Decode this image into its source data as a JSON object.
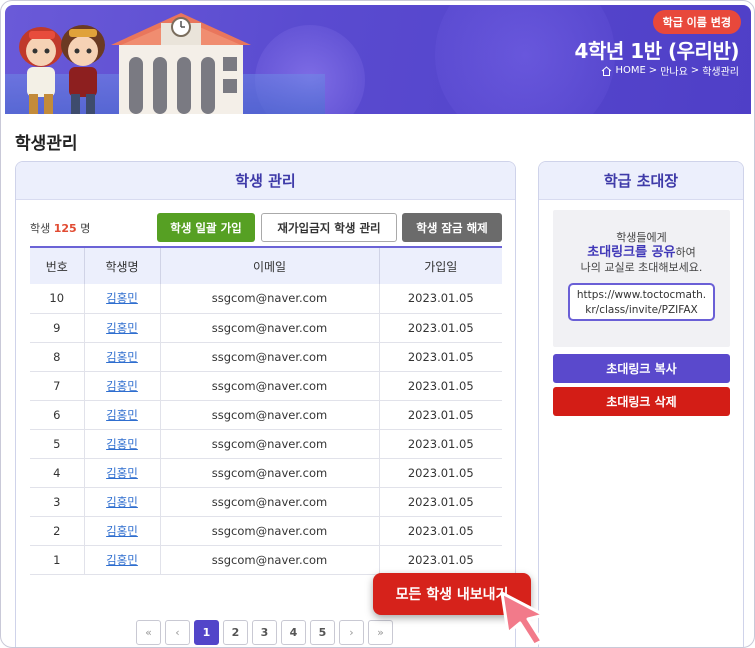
{
  "header": {
    "change_name_label": "학급 이름 변경",
    "class_title": "4학년 1반 (우리반)",
    "breadcrumb": [
      "HOME",
      ">",
      "만나요",
      ">",
      "학생관리"
    ]
  },
  "page_title": "학생관리",
  "student_panel": {
    "title": "학생 관리",
    "count_prefix": "학생",
    "count_value": "125",
    "count_suffix": "명",
    "bulk_join_label": "학생 일괄 가입",
    "rejoin_ban_label": "재가입금지 학생 관리",
    "unlock_label": "학생 잠금 해제",
    "columns": [
      "번호",
      "학생명",
      "이메일",
      "가입일"
    ],
    "rows": [
      {
        "no": "10",
        "name": "김홍민",
        "email": "ssgcom@naver.com",
        "date": "2023.01.05"
      },
      {
        "no": "9",
        "name": "김홍민",
        "email": "ssgcom@naver.com",
        "date": "2023.01.05"
      },
      {
        "no": "8",
        "name": "김홍민",
        "email": "ssgcom@naver.com",
        "date": "2023.01.05"
      },
      {
        "no": "7",
        "name": "김홍민",
        "email": "ssgcom@naver.com",
        "date": "2023.01.05"
      },
      {
        "no": "6",
        "name": "김홍민",
        "email": "ssgcom@naver.com",
        "date": "2023.01.05"
      },
      {
        "no": "5",
        "name": "김홍민",
        "email": "ssgcom@naver.com",
        "date": "2023.01.05"
      },
      {
        "no": "4",
        "name": "김홍민",
        "email": "ssgcom@naver.com",
        "date": "2023.01.05"
      },
      {
        "no": "3",
        "name": "김홍민",
        "email": "ssgcom@naver.com",
        "date": "2023.01.05"
      },
      {
        "no": "2",
        "name": "김홍민",
        "email": "ssgcom@naver.com",
        "date": "2023.01.05"
      },
      {
        "no": "1",
        "name": "김홍민",
        "email": "ssgcom@naver.com",
        "date": "2023.01.05"
      }
    ],
    "export_label": "모든 학생 내보내기"
  },
  "pagination": {
    "first": "«",
    "prev": "‹",
    "pages": [
      "1",
      "2",
      "3",
      "4",
      "5"
    ],
    "active_page": "1",
    "next": "›",
    "last": "»"
  },
  "invite_panel": {
    "title": "학급 초대장",
    "line1": "학생들에게",
    "highlight": "초대링크를 공유",
    "line2_suffix": "하여",
    "line3": "나의 교실로 초대해보세요.",
    "link": "https://www.toctocmath.kr/class/invite/PZIFAX",
    "copy_label": "초대링크 복사",
    "delete_label": "초대링크 삭제"
  },
  "colors": {
    "header_purple": "#5a4bd0",
    "accent_red": "#d6221b",
    "green": "#56a023",
    "primary": "#5a49cc"
  }
}
